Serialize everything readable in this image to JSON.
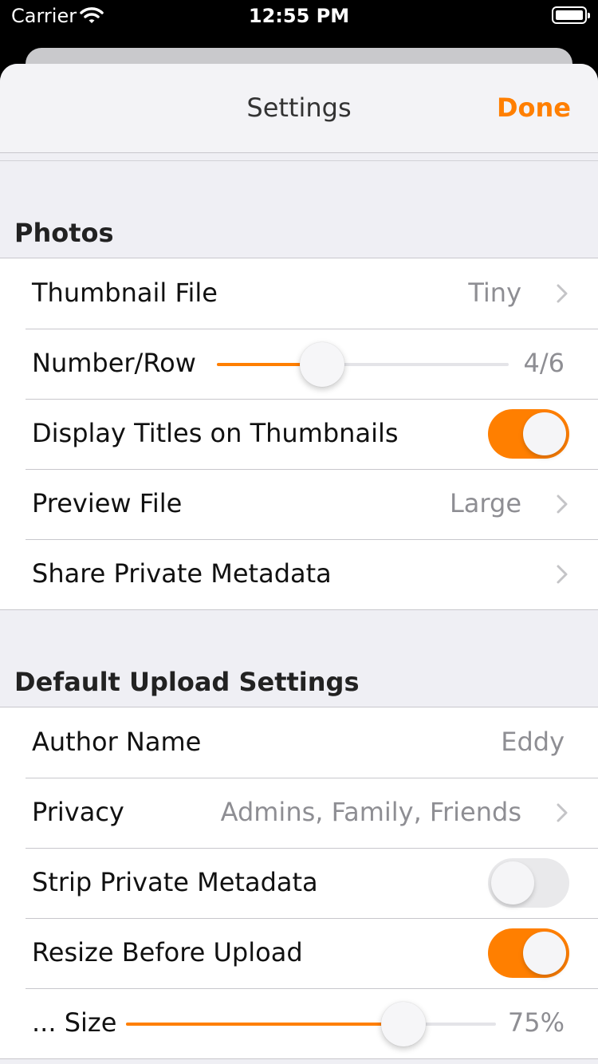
{
  "status_bar": {
    "carrier": "Carrier",
    "time": "12:55 PM"
  },
  "nav": {
    "title": "Settings",
    "done_label": "Done"
  },
  "colors": {
    "accent": "#ff7f00",
    "background": "#efeff4"
  },
  "photos": {
    "header": "Photos",
    "thumbnail_file": {
      "label": "Thumbnail File",
      "value": "Tiny"
    },
    "number_per_row": {
      "label": "Number/Row",
      "value": "4/6",
      "slider_fraction": 0.36
    },
    "display_titles": {
      "label": "Display Titles on Thumbnails",
      "on": true
    },
    "preview_file": {
      "label": "Preview File",
      "value": "Large"
    },
    "share_private_metadata": {
      "label": "Share Private Metadata"
    }
  },
  "upload": {
    "header": "Default Upload Settings",
    "author_name": {
      "label": "Author Name",
      "value": "Eddy"
    },
    "privacy": {
      "label": "Privacy",
      "value": "Admins, Family, Friends"
    },
    "strip_private_metadata": {
      "label": "Strip Private Metadata",
      "on": false
    },
    "resize_before_upload": {
      "label": "Resize Before Upload",
      "on": true
    },
    "size": {
      "label": "... Size",
      "value": "75%",
      "slider_fraction": 0.75
    }
  }
}
